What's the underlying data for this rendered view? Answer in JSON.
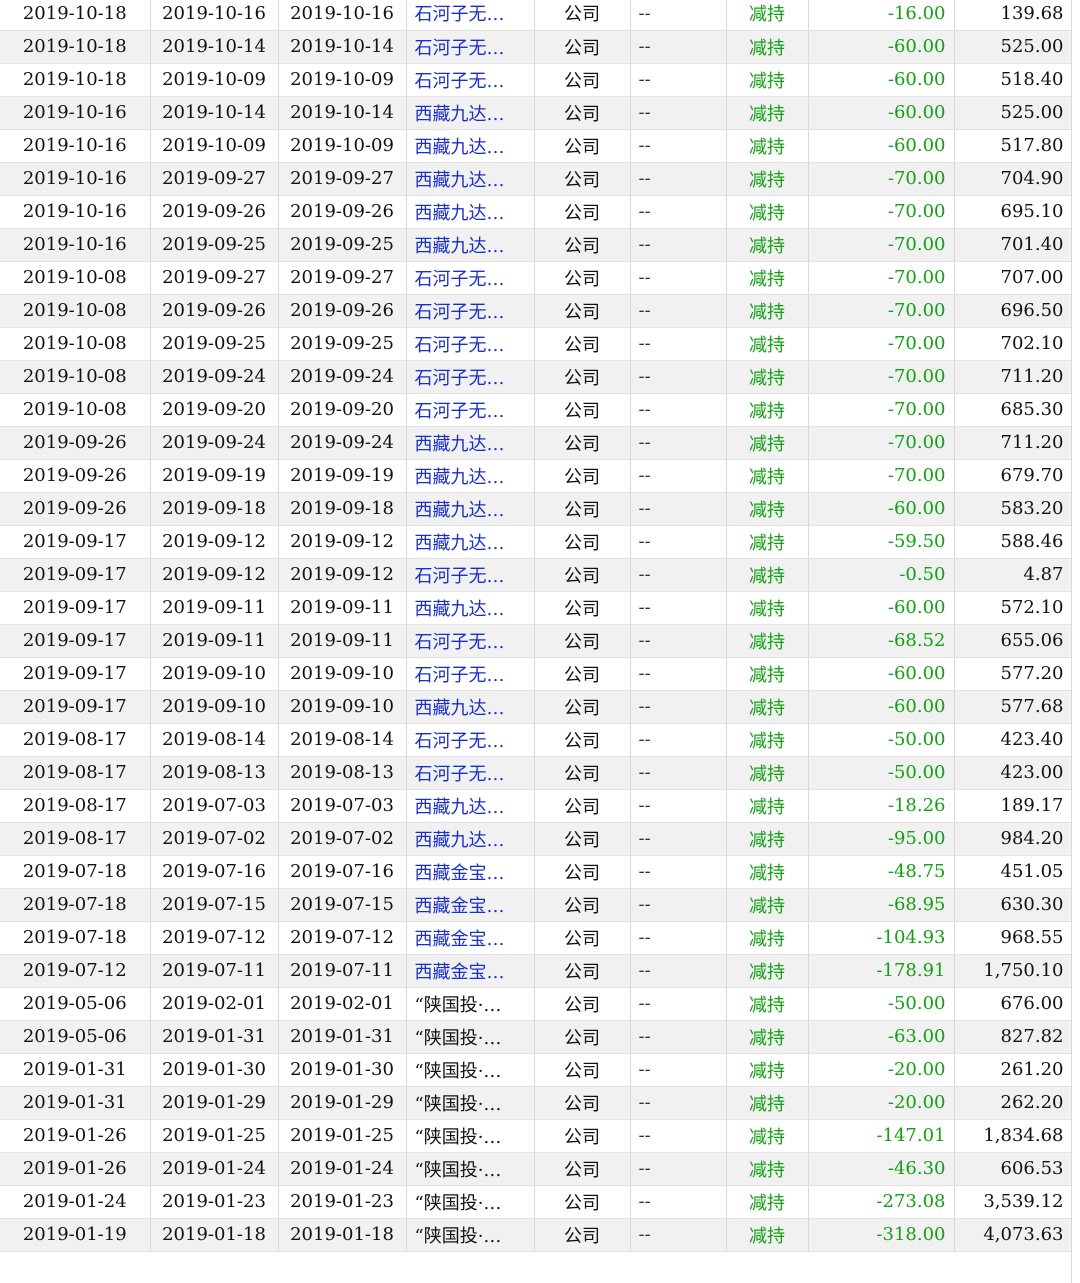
{
  "accent": {
    "link": "#1a2ec8",
    "decrease": "#13a013"
  },
  "rows": [
    {
      "notice": "2019-10-18",
      "start": "2019-10-16",
      "end": "2019-10-16",
      "holder": "石河子无…",
      "type": "公司",
      "pos": "--",
      "dir": "减持",
      "chg": "-16.00",
      "amt": "139.68",
      "link": true
    },
    {
      "notice": "2019-10-18",
      "start": "2019-10-14",
      "end": "2019-10-14",
      "holder": "石河子无…",
      "type": "公司",
      "pos": "--",
      "dir": "减持",
      "chg": "-60.00",
      "amt": "525.00",
      "link": true
    },
    {
      "notice": "2019-10-18",
      "start": "2019-10-09",
      "end": "2019-10-09",
      "holder": "石河子无…",
      "type": "公司",
      "pos": "--",
      "dir": "减持",
      "chg": "-60.00",
      "amt": "518.40",
      "link": true
    },
    {
      "notice": "2019-10-16",
      "start": "2019-10-14",
      "end": "2019-10-14",
      "holder": "西藏九达…",
      "type": "公司",
      "pos": "--",
      "dir": "减持",
      "chg": "-60.00",
      "amt": "525.00",
      "link": true
    },
    {
      "notice": "2019-10-16",
      "start": "2019-10-09",
      "end": "2019-10-09",
      "holder": "西藏九达…",
      "type": "公司",
      "pos": "--",
      "dir": "减持",
      "chg": "-60.00",
      "amt": "517.80",
      "link": true
    },
    {
      "notice": "2019-10-16",
      "start": "2019-09-27",
      "end": "2019-09-27",
      "holder": "西藏九达…",
      "type": "公司",
      "pos": "--",
      "dir": "减持",
      "chg": "-70.00",
      "amt": "704.90",
      "link": true
    },
    {
      "notice": "2019-10-16",
      "start": "2019-09-26",
      "end": "2019-09-26",
      "holder": "西藏九达…",
      "type": "公司",
      "pos": "--",
      "dir": "减持",
      "chg": "-70.00",
      "amt": "695.10",
      "link": true
    },
    {
      "notice": "2019-10-16",
      "start": "2019-09-25",
      "end": "2019-09-25",
      "holder": "西藏九达…",
      "type": "公司",
      "pos": "--",
      "dir": "减持",
      "chg": "-70.00",
      "amt": "701.40",
      "link": true
    },
    {
      "notice": "2019-10-08",
      "start": "2019-09-27",
      "end": "2019-09-27",
      "holder": "石河子无…",
      "type": "公司",
      "pos": "--",
      "dir": "减持",
      "chg": "-70.00",
      "amt": "707.00",
      "link": true
    },
    {
      "notice": "2019-10-08",
      "start": "2019-09-26",
      "end": "2019-09-26",
      "holder": "石河子无…",
      "type": "公司",
      "pos": "--",
      "dir": "减持",
      "chg": "-70.00",
      "amt": "696.50",
      "link": true
    },
    {
      "notice": "2019-10-08",
      "start": "2019-09-25",
      "end": "2019-09-25",
      "holder": "石河子无…",
      "type": "公司",
      "pos": "--",
      "dir": "减持",
      "chg": "-70.00",
      "amt": "702.10",
      "link": true
    },
    {
      "notice": "2019-10-08",
      "start": "2019-09-24",
      "end": "2019-09-24",
      "holder": "石河子无…",
      "type": "公司",
      "pos": "--",
      "dir": "减持",
      "chg": "-70.00",
      "amt": "711.20",
      "link": true
    },
    {
      "notice": "2019-10-08",
      "start": "2019-09-20",
      "end": "2019-09-20",
      "holder": "石河子无…",
      "type": "公司",
      "pos": "--",
      "dir": "减持",
      "chg": "-70.00",
      "amt": "685.30",
      "link": true
    },
    {
      "notice": "2019-09-26",
      "start": "2019-09-24",
      "end": "2019-09-24",
      "holder": "西藏九达…",
      "type": "公司",
      "pos": "--",
      "dir": "减持",
      "chg": "-70.00",
      "amt": "711.20",
      "link": true
    },
    {
      "notice": "2019-09-26",
      "start": "2019-09-19",
      "end": "2019-09-19",
      "holder": "西藏九达…",
      "type": "公司",
      "pos": "--",
      "dir": "减持",
      "chg": "-70.00",
      "amt": "679.70",
      "link": true
    },
    {
      "notice": "2019-09-26",
      "start": "2019-09-18",
      "end": "2019-09-18",
      "holder": "西藏九达…",
      "type": "公司",
      "pos": "--",
      "dir": "减持",
      "chg": "-60.00",
      "amt": "583.20",
      "link": true
    },
    {
      "notice": "2019-09-17",
      "start": "2019-09-12",
      "end": "2019-09-12",
      "holder": "西藏九达…",
      "type": "公司",
      "pos": "--",
      "dir": "减持",
      "chg": "-59.50",
      "amt": "588.46",
      "link": true
    },
    {
      "notice": "2019-09-17",
      "start": "2019-09-12",
      "end": "2019-09-12",
      "holder": "石河子无…",
      "type": "公司",
      "pos": "--",
      "dir": "减持",
      "chg": "-0.50",
      "amt": "4.87",
      "link": true
    },
    {
      "notice": "2019-09-17",
      "start": "2019-09-11",
      "end": "2019-09-11",
      "holder": "西藏九达…",
      "type": "公司",
      "pos": "--",
      "dir": "减持",
      "chg": "-60.00",
      "amt": "572.10",
      "link": true
    },
    {
      "notice": "2019-09-17",
      "start": "2019-09-11",
      "end": "2019-09-11",
      "holder": "石河子无…",
      "type": "公司",
      "pos": "--",
      "dir": "减持",
      "chg": "-68.52",
      "amt": "655.06",
      "link": true
    },
    {
      "notice": "2019-09-17",
      "start": "2019-09-10",
      "end": "2019-09-10",
      "holder": "石河子无…",
      "type": "公司",
      "pos": "--",
      "dir": "减持",
      "chg": "-60.00",
      "amt": "577.20",
      "link": true
    },
    {
      "notice": "2019-09-17",
      "start": "2019-09-10",
      "end": "2019-09-10",
      "holder": "西藏九达…",
      "type": "公司",
      "pos": "--",
      "dir": "减持",
      "chg": "-60.00",
      "amt": "577.68",
      "link": true
    },
    {
      "notice": "2019-08-17",
      "start": "2019-08-14",
      "end": "2019-08-14",
      "holder": "石河子无…",
      "type": "公司",
      "pos": "--",
      "dir": "减持",
      "chg": "-50.00",
      "amt": "423.40",
      "link": true
    },
    {
      "notice": "2019-08-17",
      "start": "2019-08-13",
      "end": "2019-08-13",
      "holder": "石河子无…",
      "type": "公司",
      "pos": "--",
      "dir": "减持",
      "chg": "-50.00",
      "amt": "423.00",
      "link": true
    },
    {
      "notice": "2019-08-17",
      "start": "2019-07-03",
      "end": "2019-07-03",
      "holder": "西藏九达…",
      "type": "公司",
      "pos": "--",
      "dir": "减持",
      "chg": "-18.26",
      "amt": "189.17",
      "link": true
    },
    {
      "notice": "2019-08-17",
      "start": "2019-07-02",
      "end": "2019-07-02",
      "holder": "西藏九达…",
      "type": "公司",
      "pos": "--",
      "dir": "减持",
      "chg": "-95.00",
      "amt": "984.20",
      "link": true
    },
    {
      "notice": "2019-07-18",
      "start": "2019-07-16",
      "end": "2019-07-16",
      "holder": "西藏金宝…",
      "type": "公司",
      "pos": "--",
      "dir": "减持",
      "chg": "-48.75",
      "amt": "451.05",
      "link": true
    },
    {
      "notice": "2019-07-18",
      "start": "2019-07-15",
      "end": "2019-07-15",
      "holder": "西藏金宝…",
      "type": "公司",
      "pos": "--",
      "dir": "减持",
      "chg": "-68.95",
      "amt": "630.30",
      "link": true
    },
    {
      "notice": "2019-07-18",
      "start": "2019-07-12",
      "end": "2019-07-12",
      "holder": "西藏金宝…",
      "type": "公司",
      "pos": "--",
      "dir": "减持",
      "chg": "-104.93",
      "amt": "968.55",
      "link": true
    },
    {
      "notice": "2019-07-12",
      "start": "2019-07-11",
      "end": "2019-07-11",
      "holder": "西藏金宝…",
      "type": "公司",
      "pos": "--",
      "dir": "减持",
      "chg": "-178.91",
      "amt": "1,750.10",
      "link": true
    },
    {
      "notice": "2019-05-06",
      "start": "2019-02-01",
      "end": "2019-02-01",
      "holder": "“陕国投·…",
      "type": "公司",
      "pos": "--",
      "dir": "减持",
      "chg": "-50.00",
      "amt": "676.00",
      "link": false
    },
    {
      "notice": "2019-05-06",
      "start": "2019-01-31",
      "end": "2019-01-31",
      "holder": "“陕国投·…",
      "type": "公司",
      "pos": "--",
      "dir": "减持",
      "chg": "-63.00",
      "amt": "827.82",
      "link": false
    },
    {
      "notice": "2019-01-31",
      "start": "2019-01-30",
      "end": "2019-01-30",
      "holder": "“陕国投·…",
      "type": "公司",
      "pos": "--",
      "dir": "减持",
      "chg": "-20.00",
      "amt": "261.20",
      "link": false
    },
    {
      "notice": "2019-01-31",
      "start": "2019-01-29",
      "end": "2019-01-29",
      "holder": "“陕国投·…",
      "type": "公司",
      "pos": "--",
      "dir": "减持",
      "chg": "-20.00",
      "amt": "262.20",
      "link": false
    },
    {
      "notice": "2019-01-26",
      "start": "2019-01-25",
      "end": "2019-01-25",
      "holder": "“陕国投·…",
      "type": "公司",
      "pos": "--",
      "dir": "减持",
      "chg": "-147.01",
      "amt": "1,834.68",
      "link": false
    },
    {
      "notice": "2019-01-26",
      "start": "2019-01-24",
      "end": "2019-01-24",
      "holder": "“陕国投·…",
      "type": "公司",
      "pos": "--",
      "dir": "减持",
      "chg": "-46.30",
      "amt": "606.53",
      "link": false
    },
    {
      "notice": "2019-01-24",
      "start": "2019-01-23",
      "end": "2019-01-23",
      "holder": "“陕国投·…",
      "type": "公司",
      "pos": "--",
      "dir": "减持",
      "chg": "-273.08",
      "amt": "3,539.12",
      "link": false
    },
    {
      "notice": "2019-01-19",
      "start": "2019-01-18",
      "end": "2019-01-18",
      "holder": "“陕国投·…",
      "type": "公司",
      "pos": "--",
      "dir": "减持",
      "chg": "-318.00",
      "amt": "4,073.63",
      "link": false
    }
  ]
}
